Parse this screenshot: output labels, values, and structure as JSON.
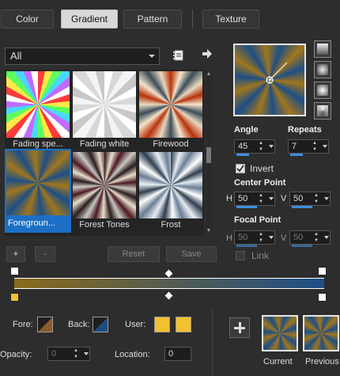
{
  "tabs": [
    "Color",
    "Gradient",
    "Pattern",
    "Texture"
  ],
  "active_tab": "Gradient",
  "category": {
    "selected": "All"
  },
  "gradients": [
    {
      "name": "Fading spe...",
      "selected": false
    },
    {
      "name": "Fading white",
      "selected": false
    },
    {
      "name": "Firewood",
      "selected": false
    },
    {
      "name": "Foregroun...",
      "selected": true
    },
    {
      "name": "Forest Tones",
      "selected": false
    },
    {
      "name": "Frost",
      "selected": false
    }
  ],
  "buttons": {
    "add": "+",
    "remove": "-",
    "reset": "Reset",
    "save": "Save"
  },
  "angle": {
    "label": "Angle",
    "value": "45"
  },
  "repeats": {
    "label": "Repeats",
    "value": "7"
  },
  "invert": {
    "label": "Invert",
    "checked": true
  },
  "center_point": {
    "label": "Center Point",
    "h_label": "H",
    "h": "50",
    "v_label": "V",
    "v": "50"
  },
  "focal_point": {
    "label": "Focal Point",
    "h_label": "H",
    "h": "50",
    "v_label": "V",
    "v": "50"
  },
  "link": {
    "label": "Link",
    "checked": false
  },
  "fore": {
    "label": "Fore:"
  },
  "back": {
    "label": "Back:"
  },
  "user": {
    "label": "User:",
    "colors": [
      "#f2c12e",
      "#f2c12e"
    ]
  },
  "opacity": {
    "label": "Opacity:",
    "value": "0"
  },
  "location": {
    "label": "Location:",
    "value": "0"
  },
  "current_label": "Current",
  "previous_label": "Previous",
  "colors": {
    "gold": "#a0761c",
    "navy": "#1e4e86",
    "accent": "#1c6fc4"
  }
}
